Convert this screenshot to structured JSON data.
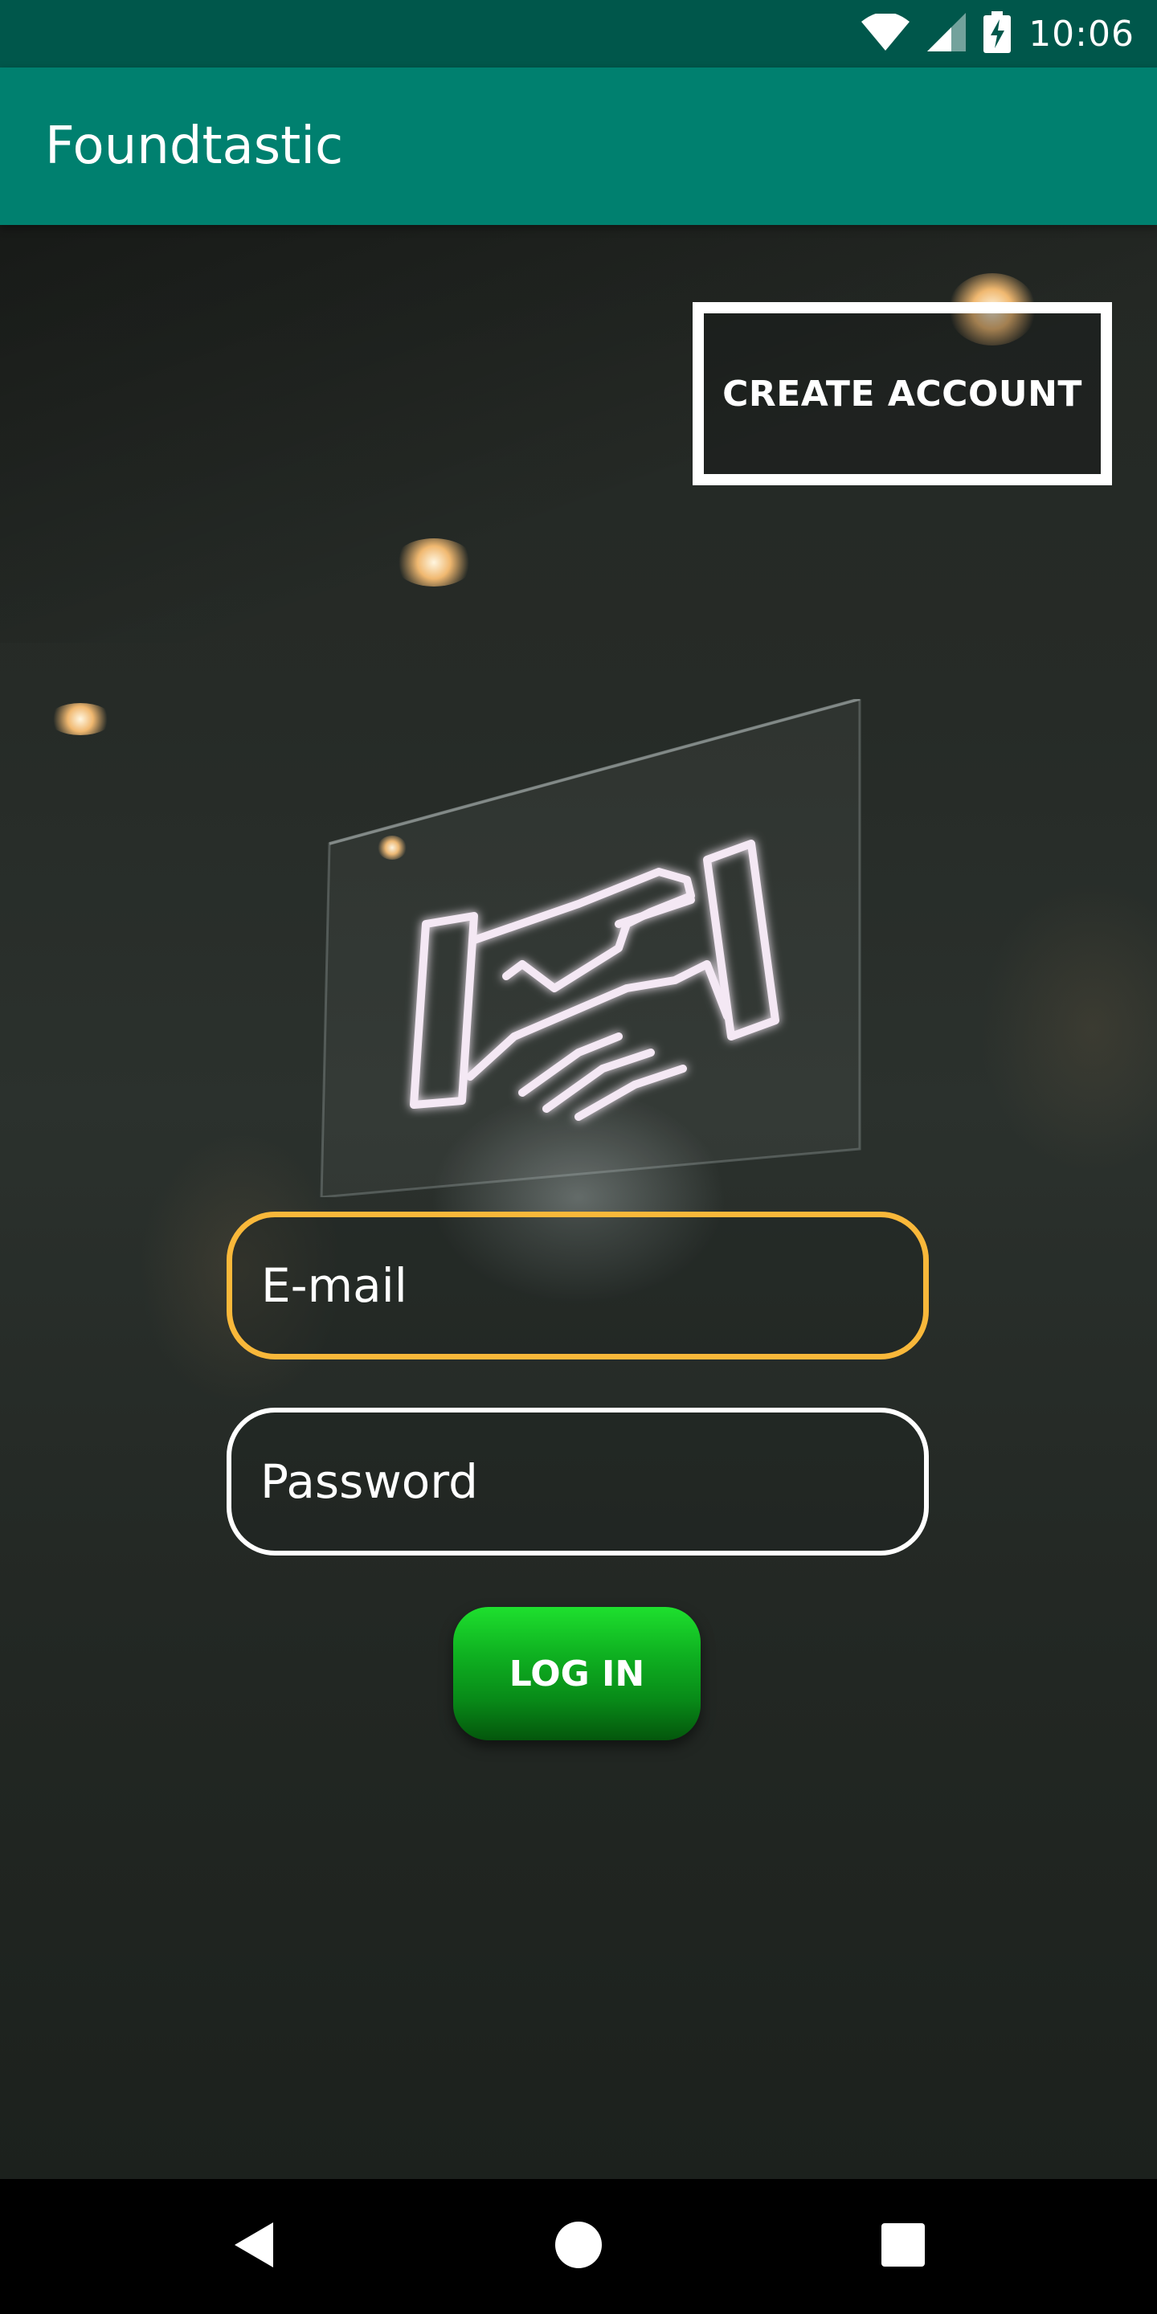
{
  "status_bar": {
    "time": "10:06",
    "icons": [
      "wifi-icon",
      "signal-icon",
      "battery-charging-icon"
    ]
  },
  "app_bar": {
    "title": "Foundtastic"
  },
  "background": {
    "description_icon": "neon-handshake-icon"
  },
  "create_account": {
    "label": "CREATE ACCOUNT"
  },
  "login_form": {
    "email_placeholder": "E-mail",
    "email_value": "",
    "password_placeholder": "Password",
    "password_value": "",
    "login_label": "LOG IN"
  },
  "nav_bar": {
    "icons": [
      "back-icon",
      "home-icon",
      "recents-icon"
    ]
  },
  "colors": {
    "status_bar": "#00574b",
    "app_bar": "#00806f",
    "email_focus_border": "#f9b83a",
    "login_button": "#0fb221"
  }
}
